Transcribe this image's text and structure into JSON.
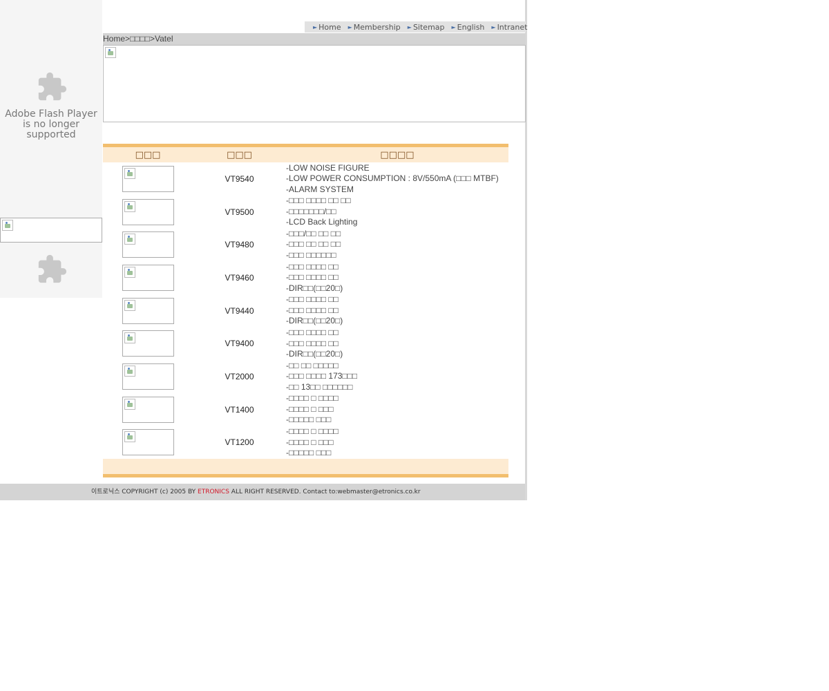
{
  "sidebar": {
    "flash_message": "Adobe Flash Player is no longer supported"
  },
  "nav": {
    "items": [
      {
        "label": "Home"
      },
      {
        "label": "Membership"
      },
      {
        "label": "Sitemap"
      },
      {
        "label": "English"
      },
      {
        "label": "Intranet"
      }
    ]
  },
  "breadcrumb": {
    "text": "Home>□□□□>Vatel"
  },
  "table": {
    "headers": [
      "□□□",
      "□□□",
      "□□□□"
    ],
    "rows": [
      {
        "model": "VT9540",
        "features": [
          "-LOW NOISE FIGURE",
          "-LOW POWER CONSUMPTION : 8V/550mA (□□□ MTBF)",
          "-ALARM SYSTEM"
        ]
      },
      {
        "model": "VT9500",
        "features": [
          "-□□□ □□□□ □□ □□",
          "-□□□□□□□/□□",
          "-LCD Back Lighting"
        ]
      },
      {
        "model": "VT9480",
        "features": [
          "-□□□/□□ □□ □□",
          "-□□□ □□ □□ □□",
          "-□□□ □□□□□□"
        ]
      },
      {
        "model": "VT9460",
        "features": [
          "-□□□ □□□□ □□",
          "-□□□ □□□□ □□",
          "-DIR□□(□□20□)"
        ]
      },
      {
        "model": "VT9440",
        "features": [
          "-□□□ □□□□ □□",
          "-□□□ □□□□ □□",
          "-DIR□□(□□20□)"
        ]
      },
      {
        "model": "VT9400",
        "features": [
          "-□□□ □□□□ □□",
          "-□□□ □□□□ □□",
          "-DIR□□(□□20□)"
        ]
      },
      {
        "model": "VT2000",
        "features": [
          "-□□ □□ □□□□□",
          "-□□□ □□□□ 173□□□",
          "-□□ 13□□ □□□□□□"
        ]
      },
      {
        "model": "VT1400",
        "features": [
          "-□□□□ □ □□□□",
          "-□□□□ □ □□□",
          "-□□□□□ □□□"
        ]
      },
      {
        "model": "VT1200",
        "features": [
          "-□□□□ □ □□□□",
          "-□□□□ □ □□□",
          "-□□□□□ □□□"
        ]
      }
    ]
  },
  "footer": {
    "prefix": "이트로닉스 COPYRIGHT (c) 2005 BY ",
    "brand": "ETRONICS",
    "suffix": " ALL RIGHT RESERVED.  Contact to:webmaster@etronics.co.kr",
    "brand_color": "#d21a2a"
  }
}
